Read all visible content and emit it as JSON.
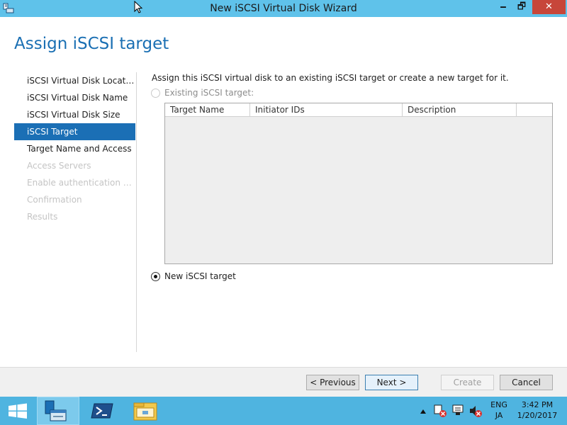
{
  "window": {
    "title": "New iSCSI Virtual Disk Wizard",
    "controls": {
      "minimize": "🗕",
      "maximize": "🗗",
      "close": "✕"
    }
  },
  "page": {
    "title": "Assign iSCSI target"
  },
  "nav": {
    "items": [
      {
        "label": "iSCSI Virtual Disk Location",
        "state": "normal"
      },
      {
        "label": "iSCSI Virtual Disk Name",
        "state": "normal"
      },
      {
        "label": "iSCSI Virtual Disk Size",
        "state": "normal"
      },
      {
        "label": "iSCSI Target",
        "state": "active"
      },
      {
        "label": "Target Name and Access",
        "state": "normal"
      },
      {
        "label": "Access Servers",
        "state": "disabled"
      },
      {
        "label": "Enable authentication ser...",
        "state": "disabled"
      },
      {
        "label": "Confirmation",
        "state": "disabled"
      },
      {
        "label": "Results",
        "state": "disabled"
      }
    ]
  },
  "content": {
    "instruction": "Assign this iSCSI virtual disk to an existing iSCSI target or create a new target for it.",
    "existing_target": {
      "label": "Existing iSCSI target:",
      "checked": false,
      "enabled": false
    },
    "grid": {
      "columns": [
        "Target Name",
        "Initiator IDs",
        "Description",
        ""
      ]
    },
    "new_target": {
      "label": "New iSCSI target",
      "checked": true,
      "enabled": true
    }
  },
  "footer": {
    "previous": "< Previous",
    "next": "Next >",
    "create": "Create",
    "cancel": "Cancel"
  },
  "taskbar": {
    "apps": [
      "start-icon",
      "server-manager-icon",
      "powershell-icon",
      "file-explorer-icon"
    ],
    "lang": {
      "line1": "ENG",
      "line2": "JA"
    },
    "clock": {
      "time": "3:42 PM",
      "date": "1/20/2017"
    }
  },
  "colors": {
    "title_bar": "#5fc2ea",
    "accent": "#1b6fb5",
    "page_title": "#1a6fb3",
    "taskbar": "#4fb4e0",
    "close_button": "#c7463a"
  }
}
